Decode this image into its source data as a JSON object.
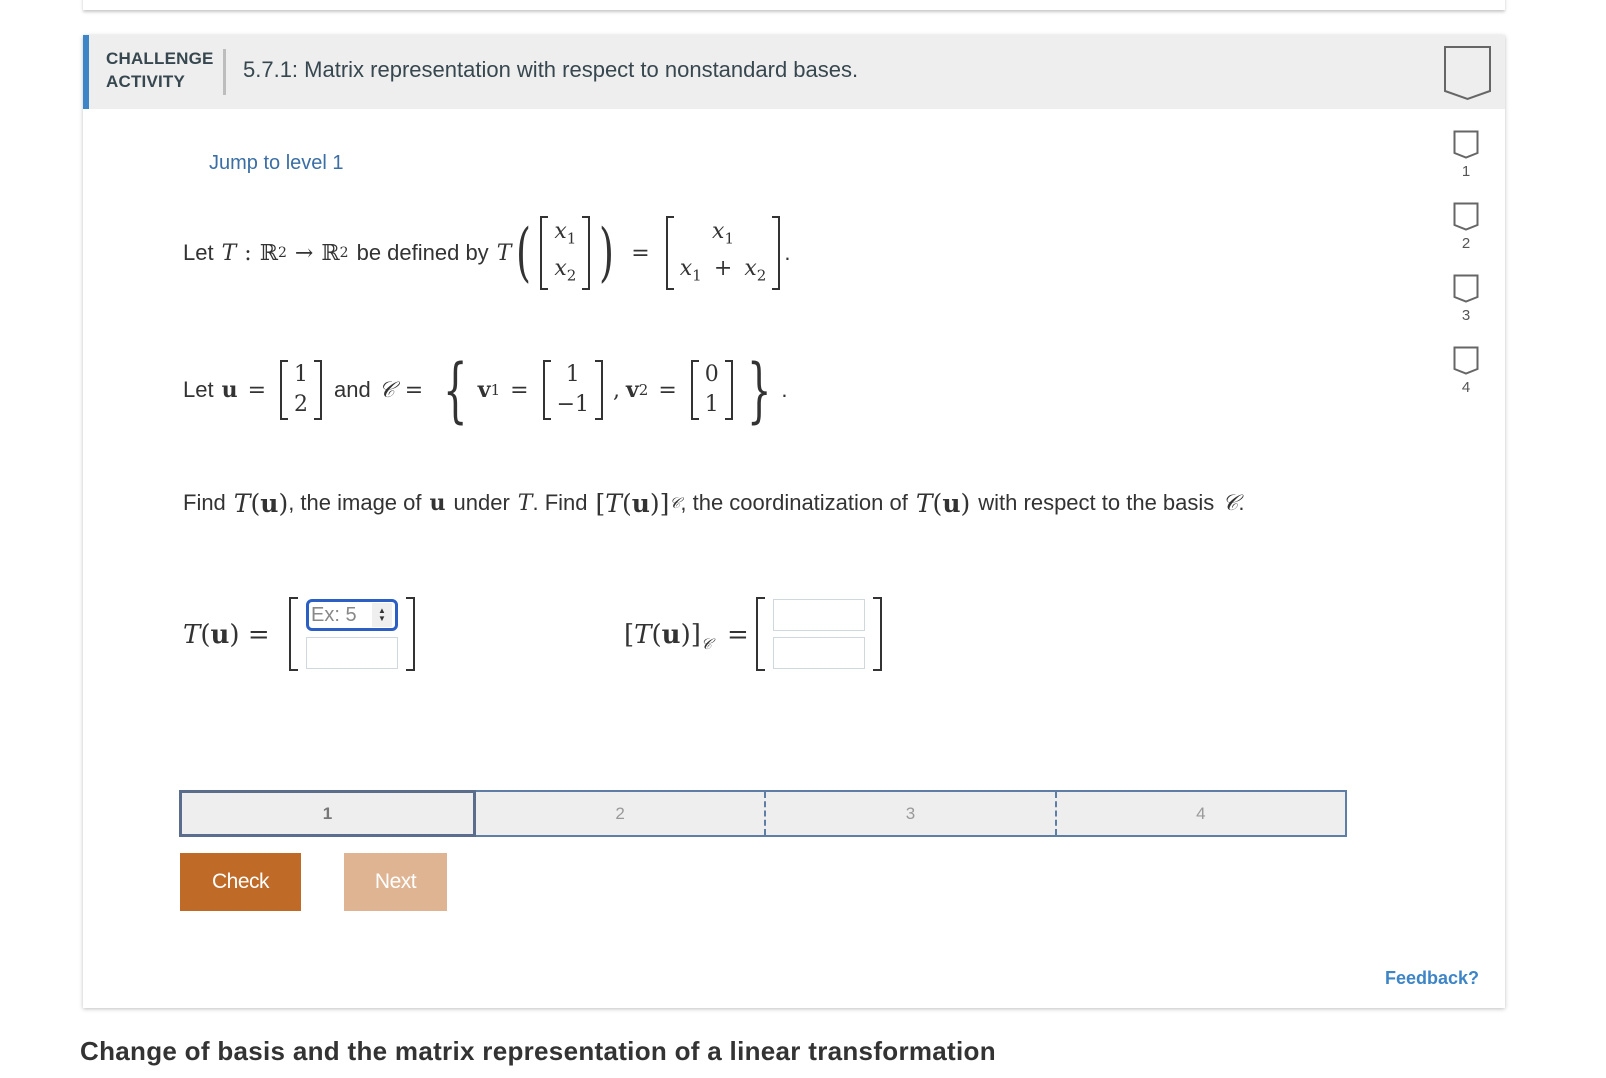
{
  "activity": {
    "type_label_line1": "CHALLENGE",
    "type_label_line2": "ACTIVITY",
    "title": "5.7.1: Matrix representation with respect to nonstandard bases.",
    "jump_link": "Jump to level 1",
    "levels": [
      "1",
      "2",
      "3",
      "4"
    ]
  },
  "problem": {
    "line1": {
      "let": "Let",
      "T": "T",
      "colon": ":",
      "R": "ℝ",
      "exp": "2",
      "arrow": "→",
      "defined_by": "be defined by",
      "x1": "x",
      "x1_sub": "1",
      "x2": "x",
      "x2_sub": "2",
      "equals": "=",
      "sum_op": "+",
      "period": "."
    },
    "line2": {
      "let": "Let",
      "u": "u",
      "equals": "=",
      "u_vec": [
        "1",
        "2"
      ],
      "and": "and",
      "C": "𝒞",
      "v": "v",
      "v1_sub": "1",
      "v1_vec": [
        "1",
        "−1"
      ],
      "comma": ",",
      "v2_sub": "2",
      "v2_vec": [
        "0",
        "1"
      ],
      "period": "."
    },
    "line3": {
      "find1": "Find",
      "image_text": ", the image of",
      "under": "under",
      "find2": ". Find",
      "coord_text": ", the coordinatization of",
      "respect_text": "with respect to the basis",
      "period": "."
    }
  },
  "answers": {
    "Tu_label": "T(u) =",
    "TuC_label": "[T(u)]",
    "TuC_sub": "𝒞",
    "TuC_eq": "=",
    "Tu_inputs": [
      {
        "placeholder": "Ex: 5",
        "value": ""
      },
      {
        "placeholder": "",
        "value": ""
      }
    ],
    "TuC_inputs": [
      {
        "placeholder": "",
        "value": ""
      },
      {
        "placeholder": "",
        "value": ""
      }
    ]
  },
  "progress": {
    "segments": [
      "1",
      "2",
      "3",
      "4"
    ],
    "current": 1
  },
  "buttons": {
    "check": "Check",
    "next": "Next"
  },
  "feedback": "Feedback?",
  "bottom_heading": "Change of basis and the matrix representation of a linear transformation",
  "colors": {
    "accent": "#3d85c6",
    "check_button": "#bf6a27",
    "next_button_disabled": "#dfb493",
    "progress_border": "#5f7ea6"
  }
}
